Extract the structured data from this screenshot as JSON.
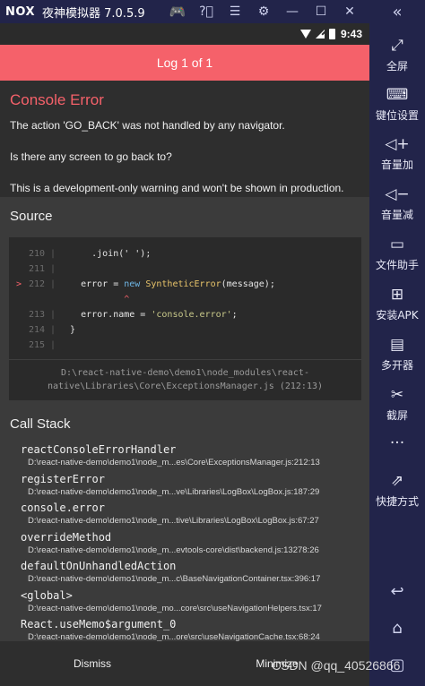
{
  "window": {
    "logo": "NOX",
    "title": "夜神模拟器 7.0.5.9",
    "icons": [
      "gamepad-icon",
      "help-icon",
      "menu-icon",
      "settings-icon",
      "minimize-icon",
      "maximize-icon",
      "close-icon"
    ],
    "collapse_icon": "double-chevron-left-icon"
  },
  "sidebar": {
    "items": [
      {
        "icon": "fullscreen-icon",
        "glyph": "⤢",
        "label": "全屏"
      },
      {
        "icon": "keyboard-icon",
        "glyph": "⌨",
        "label": "键位设置"
      },
      {
        "icon": "volume-up-icon",
        "glyph": "◁+",
        "label": "音量加"
      },
      {
        "icon": "volume-down-icon",
        "glyph": "◁−",
        "label": "音量减"
      },
      {
        "icon": "file-helper-icon",
        "glyph": "▭",
        "label": "文件助手"
      },
      {
        "icon": "install-apk-icon",
        "glyph": "⊞",
        "label": "安装APK"
      },
      {
        "icon": "multi-instance-icon",
        "glyph": "▤",
        "label": "多开器"
      },
      {
        "icon": "screenshot-icon",
        "glyph": "✂",
        "label": "截屏"
      },
      {
        "icon": "more-icon",
        "glyph": "···",
        "label": ""
      },
      {
        "icon": "shortcut-icon",
        "glyph": "⇗",
        "label": "快捷方式"
      }
    ],
    "nav": [
      {
        "icon": "back-icon",
        "glyph": "↩"
      },
      {
        "icon": "home-icon",
        "glyph": "⌂"
      },
      {
        "icon": "recent-apps-icon",
        "glyph": "▢"
      }
    ]
  },
  "statusbar": {
    "time": "9:43"
  },
  "header": {
    "title": "Log 1 of 1"
  },
  "error": {
    "title": "Console Error",
    "lines": [
      "The action 'GO_BACK' was not handled by any navigator.",
      "Is there any screen to go back to?",
      "This is a development-only warning and won't be shown in production."
    ]
  },
  "source": {
    "title": "Source",
    "lines": [
      {
        "marker": "",
        "num": "210",
        "parts": [
          {
            "t": "      .join(' ');",
            "c": ""
          }
        ]
      },
      {
        "marker": "",
        "num": "211",
        "parts": [
          {
            "t": "",
            "c": ""
          }
        ]
      },
      {
        "marker": ">",
        "num": "212",
        "parts": [
          {
            "t": "    error = ",
            "c": ""
          },
          {
            "t": "new",
            "c": "kw"
          },
          {
            "t": " ",
            "c": ""
          },
          {
            "t": "SyntheticError",
            "c": "cls"
          },
          {
            "t": "(message);",
            "c": ""
          }
        ]
      },
      {
        "marker": "",
        "num": "",
        "parts": [
          {
            "t": "            ^",
            "c": "caret"
          }
        ]
      },
      {
        "marker": "",
        "num": "213",
        "parts": [
          {
            "t": "    error.name = ",
            "c": ""
          },
          {
            "t": "'console.error'",
            "c": "str"
          },
          {
            "t": ";",
            "c": ""
          }
        ]
      },
      {
        "marker": "",
        "num": "214",
        "parts": [
          {
            "t": "  }",
            "c": ""
          }
        ]
      },
      {
        "marker": "",
        "num": "215",
        "parts": [
          {
            "t": "",
            "c": ""
          }
        ]
      }
    ],
    "path_line1": "D:\\react-native-demo\\demo1\\node_modules\\react-",
    "path_line2": "native\\Libraries\\Core\\ExceptionsManager.js (212:13)"
  },
  "callstack": {
    "title": "Call Stack",
    "frames": [
      {
        "fn": "reactConsoleErrorHandler",
        "path": "D:\\react-native-demo\\demo1\\node_m...es\\Core\\ExceptionsManager.js:212:13"
      },
      {
        "fn": "registerError",
        "path": "D:\\react-native-demo\\demo1\\node_m...ve\\Libraries\\LogBox\\LogBox.js:187:29"
      },
      {
        "fn": "console.error",
        "path": "D:\\react-native-demo\\demo1\\node_m...tive\\Libraries\\LogBox\\LogBox.js:67:27"
      },
      {
        "fn": "overrideMethod",
        "path": "D:\\react-native-demo\\demo1\\node_m...evtools-core\\dist\\backend.js:13278:26"
      },
      {
        "fn": "defaultOnUnhandledAction",
        "path": "D:\\react-native-demo\\demo1\\node_m...c\\BaseNavigationContainer.tsx:396:17"
      },
      {
        "fn": "<global>",
        "path": "D:\\react-native-demo\\demo1\\node_mo...core\\src\\useNavigationHelpers.tsx:17"
      },
      {
        "fn": "React.useMemo$argument_0",
        "path": "D:\\react-native-demo\\demo1\\node_m...ore\\src\\useNavigationCache.tsx:68:24"
      }
    ]
  },
  "footer": {
    "dismiss": "Dismiss",
    "minimize": "Minimize"
  },
  "watermark": "CSDN @qq_40526866",
  "colors": {
    "accent": "#f5616a",
    "background": "#3b3b3b",
    "chrome": "#22244a"
  }
}
